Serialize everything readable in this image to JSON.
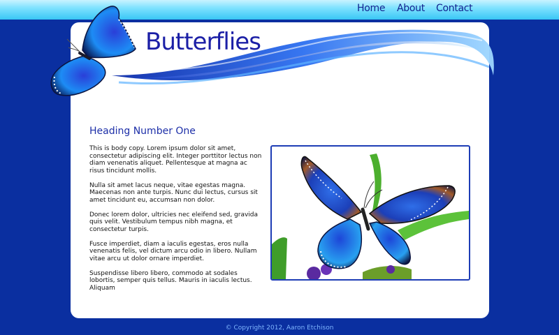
{
  "nav": {
    "items": [
      {
        "label": "Home"
      },
      {
        "label": "About"
      },
      {
        "label": "Contact"
      }
    ]
  },
  "header": {
    "site_title": "Butterflies",
    "logo_icon": "butterfly-icon"
  },
  "main": {
    "heading": "Heading Number One",
    "paragraphs": [
      "This is body copy. Lorem ipsum dolor sit amet, consectetur adipiscing elit. Integer porttitor lectus non diam venenatis aliquet. Pellentesque at magna ac risus tincidunt mollis.",
      "Nulla sit amet lacus neque, vitae egestas magna. Maecenas non ante turpis. Nunc dui lectus, cursus sit amet tincidunt eu, accumsan non dolor.",
      "Donec lorem dolor, ultricies nec eleifend sed, gravida quis velit. Vestibulum tempus nibh magna, et consectetur turpis.",
      "Fusce imperdiet, diam a iaculis egestas, eros nulla venenatis felis, vel dictum arcu odio in libero. Nullam vitae arcu ut dolor ornare imperdiet.",
      "Suspendisse libero libero, commodo at sodales lobortis, semper quis tellus. Mauris in iaculis lectus. Aliquam"
    ],
    "photo_icon": "butterfly-photo"
  },
  "footer": {
    "copyright": "© Copyright 2012, Aaron Etchison"
  },
  "colors": {
    "page_bg": "#0a2fa0",
    "topbar": "#7fe2ff",
    "title": "#1b1fa6",
    "heading": "#1d2fa8",
    "photo_border": "#1e3db5",
    "footer_text": "#7fb6ff"
  }
}
